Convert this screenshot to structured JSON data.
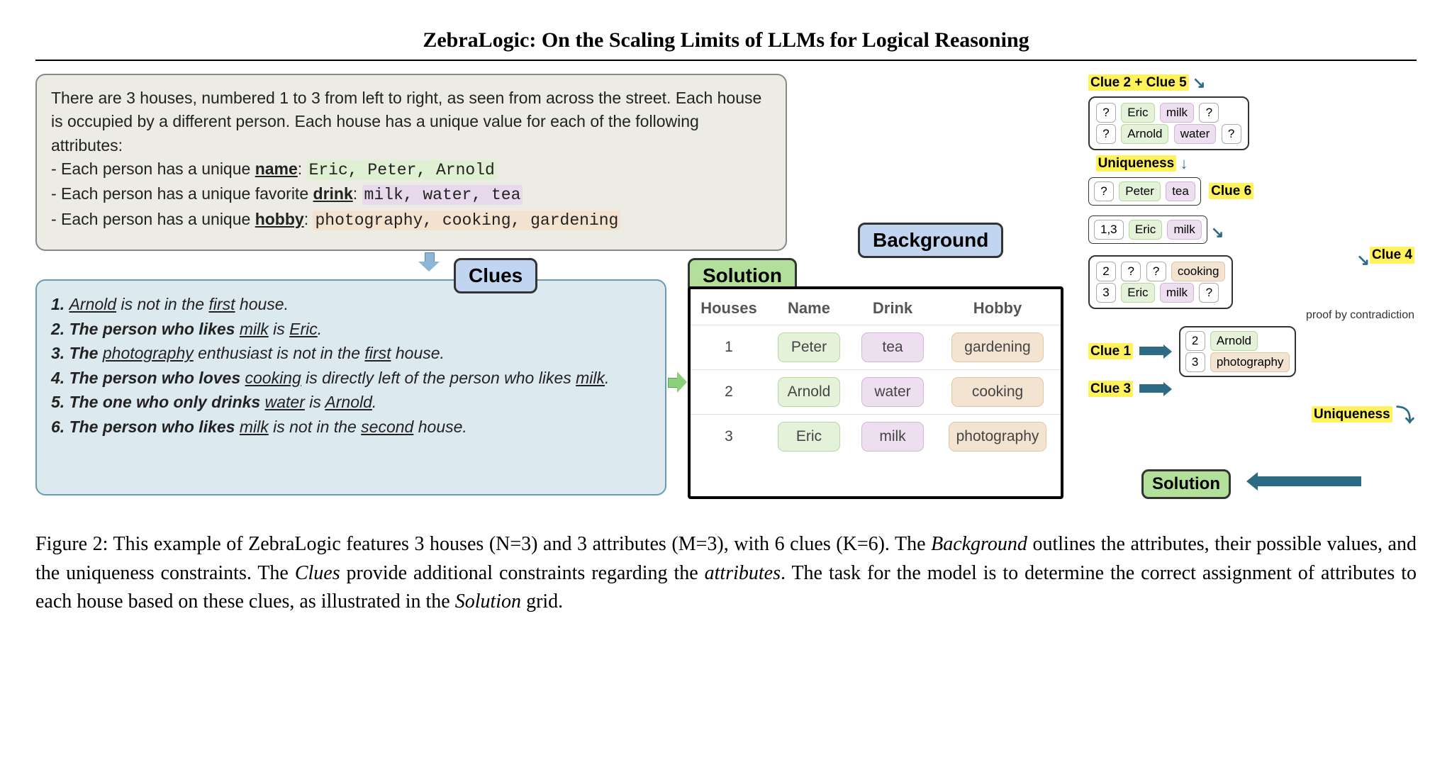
{
  "title": "ZebraLogic: On the Scaling Limits of LLMs for Logical Reasoning",
  "bg": {
    "intro1": "There are 3 houses, numbered 1 to 3 from left to right, as seen from across the street. Each house is occupied by a different person. Each house has a unique value for each of the following attributes:",
    "line1_prefix": "- Each person has a unique ",
    "name_label": "name",
    "name_vals": "Eric, Peter, Arnold",
    "line2_prefix": "- Each person has a unique favorite ",
    "drink_label": "drink",
    "drink_vals": "milk, water, tea",
    "line3_prefix": "- Each person has a unique ",
    "hobby_label": "hobby",
    "hobby_vals": "photography, cooking, gardening"
  },
  "tags": {
    "background": "Background",
    "clues": "Clues",
    "solution": "Solution"
  },
  "clues": {
    "c1_a": "1. ",
    "c1_b": "Arnold",
    "c1_c": " is not in the ",
    "c1_d": "first",
    "c1_e": " house.",
    "c2_a": "2. The person who likes ",
    "c2_b": "milk",
    "c2_c": " is ",
    "c2_d": "Eric",
    "c2_e": ".",
    "c3_a": "3. The ",
    "c3_b": "photography",
    "c3_c": " enthusiast is not in the ",
    "c3_d": "first",
    "c3_e": " house.",
    "c4_a": "4. The person who loves ",
    "c4_b": "cooking",
    "c4_c": " is directly left of the person who likes ",
    "c4_d": "milk",
    "c4_e": ".",
    "c5_a": "5. The one who only drinks ",
    "c5_b": "water",
    "c5_c": " is ",
    "c5_d": "Arnold",
    "c5_e": ".",
    "c6_a": "6. The person who likes ",
    "c6_b": "milk",
    "c6_c": " is not in the ",
    "c6_d": "second",
    "c6_e": " house."
  },
  "solution": {
    "headers": {
      "houses": "Houses",
      "name": "Name",
      "drink": "Drink",
      "hobby": "Hobby"
    },
    "rows": [
      {
        "idx": "1",
        "name": "Peter",
        "drink": "tea",
        "hobby": "gardening"
      },
      {
        "idx": "2",
        "name": "Arnold",
        "drink": "water",
        "hobby": "cooking"
      },
      {
        "idx": "3",
        "name": "Eric",
        "drink": "milk",
        "hobby": "photography"
      }
    ]
  },
  "trace": {
    "head1": "Clue 2 + Clue 5",
    "q": "?",
    "s1r1": {
      "name": "Eric",
      "drink": "milk"
    },
    "s1r2": {
      "name": "Arnold",
      "drink": "water"
    },
    "uniq": "Uniqueness",
    "s2": {
      "name": "Peter",
      "drink": "tea"
    },
    "clue6": "Clue 6",
    "s3": {
      "idx": "1,3",
      "name": "Eric",
      "drink": "milk"
    },
    "clue4": "Clue 4",
    "s4r1": {
      "idx": "2",
      "hobby": "cooking"
    },
    "s4r2": {
      "idx": "3",
      "name": "Eric",
      "drink": "milk"
    },
    "contra": "proof by contradiction",
    "clue1": "Clue 1",
    "clue3": "Clue 3",
    "s5r1": {
      "idx": "2",
      "name": "Arnold"
    },
    "s5r2": {
      "idx": "3",
      "hobby": "photography"
    }
  },
  "caption": {
    "full": "Figure 2: This example of ZebraLogic features 3 houses (N=3) and 3 attributes (M=3), with 6 clues (K=6). The Background outlines the attributes, their possible values, and the uniqueness constraints. The Clues provide additional constraints regarding the attributes. The task for the model is to determine the correct assignment of attributes to each house based on these clues, as illustrated in the Solution grid.",
    "p1": "Figure 2: This example of ZebraLogic features 3 houses (N=3) and 3 attributes (M=3), with 6 clues (K=6). The ",
    "em1": "Background",
    "p2": " outlines the attributes, their possible values, and the uniqueness constraints. The ",
    "em2": "Clues",
    "p3": " provide additional constraints regarding the ",
    "em3": "attributes",
    "p4": ". The task for the model is to determine the correct assignment of attributes to each house based on these clues, as illustrated in the ",
    "em4": "Solution",
    "p5": " grid."
  }
}
